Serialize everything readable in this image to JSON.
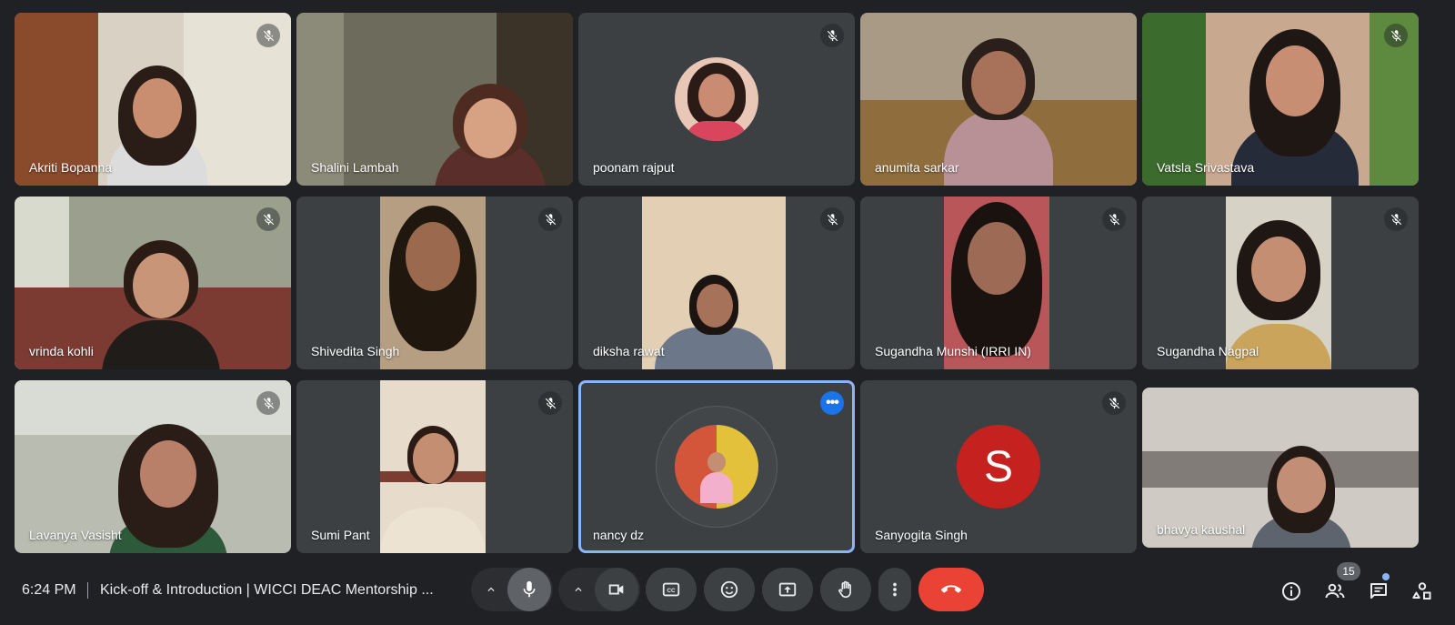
{
  "participants": [
    {
      "name": "Akriti Bopanna",
      "muted": true
    },
    {
      "name": "Shalini Lambah",
      "muted": false
    },
    {
      "name": "poonam rajput",
      "muted": true
    },
    {
      "name": "anumita sarkar",
      "muted": false
    },
    {
      "name": "Vatsla Srivastava",
      "muted": true
    },
    {
      "name": "vrinda kohli",
      "muted": true
    },
    {
      "name": "Shivedita Singh",
      "muted": true
    },
    {
      "name": "diksha rawat",
      "muted": true
    },
    {
      "name": "Sugandha Munshi (IRRI IN)",
      "muted": true
    },
    {
      "name": "Sugandha Nagpal",
      "muted": true
    },
    {
      "name": "Lavanya Vasisht",
      "muted": true
    },
    {
      "name": "Sumi Pant",
      "muted": true
    },
    {
      "name": "nancy dz",
      "muted": false,
      "active_speaker": true
    },
    {
      "name": "Sanyogita Singh",
      "muted": true,
      "avatar_letter": "S"
    },
    {
      "name": "bhavya kaushal",
      "muted": false
    }
  ],
  "bottom_bar": {
    "time": "6:24 PM",
    "meeting_title": "Kick-off & Introduction | WICCI DEAC Mentorship ...",
    "people_count": "15"
  },
  "icons": {
    "mic": "mic-icon",
    "camera": "video-camera-icon",
    "captions": "closed-captions-icon",
    "reactions": "emoji-icon",
    "present": "present-screen-icon",
    "raise_hand": "hand-icon",
    "more": "more-vert-icon",
    "end_call": "phone-hangup-icon",
    "info": "info-icon",
    "people": "people-icon",
    "chat": "chat-icon",
    "activities": "activities-icon"
  },
  "colors": {
    "background": "#202124",
    "tile": "#3c4043",
    "end_call": "#ea4335",
    "active_border": "#8ab4f8",
    "avatar_s": "#c5221f"
  }
}
